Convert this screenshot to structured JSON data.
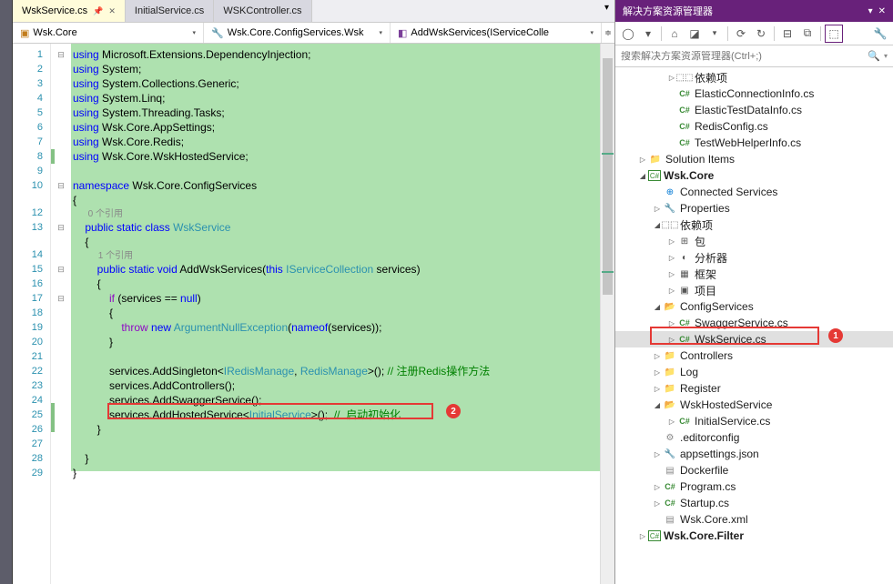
{
  "tabs": [
    {
      "label": "WskService.cs",
      "active": true
    },
    {
      "label": "InitialService.cs",
      "active": false
    },
    {
      "label": "WSKController.cs",
      "active": false
    }
  ],
  "nav": {
    "project": "Wsk.Core",
    "class": "Wsk.Core.ConfigServices.Wsk",
    "method": "AddWskServices(IServiceColle"
  },
  "lines": [
    "1",
    "2",
    "3",
    "4",
    "5",
    "6",
    "7",
    "8",
    "9",
    "10",
    "",
    "12",
    "13",
    "",
    "14",
    "15",
    "16",
    "17",
    "18",
    "19",
    "20",
    "21",
    "22",
    "23",
    "24",
    "25",
    "26",
    "27",
    "28",
    "29"
  ],
  "ref1": "0 个引用",
  "ref2": "1 个引用",
  "code": {
    "using1": "Microsoft.Extensions.DependencyInjection",
    "using2": "System",
    "using3": "System.Collections.Generic",
    "using4": "System.Linq",
    "using5": "System.Threading.Tasks",
    "using6": "Wsk.Core.AppSettings",
    "using7": "Wsk.Core.Redis",
    "using8": "Wsk.Core.WskHostedService",
    "namespace_kw": "namespace",
    "namespace": "Wsk.Core.ConfigServices",
    "class_decl": "WskService",
    "method_ret": "void",
    "method_name": "AddWskServices",
    "this_kw": "this",
    "param_ty": "IServiceCollection",
    "param_nm": "services",
    "if_kw": "if",
    "null_kw": "null",
    "throw_kw": "throw",
    "new_kw": "new",
    "ane": "ArgumentNullException",
    "nameof": "nameof",
    "addsingle": "AddSingleton",
    "imanage": "IRedisManage",
    "manage": "RedisManage",
    "cm1": "// 注册Redis操作方法",
    "addctrl": "AddControllers",
    "addswag": "AddSwaggerService",
    "addhost": "AddHostedService",
    "initsvc": "InitialService",
    "cm2": "//  启动初始化"
  },
  "panel": {
    "title": "解决方案资源管理器",
    "search_placeholder": "搜索解决方案资源管理器(Ctrl+;)"
  },
  "tree": [
    {
      "depth": 3,
      "exp": "▷",
      "icon": "ref",
      "glyph": "⬚⬚",
      "label": "依赖项"
    },
    {
      "depth": 3,
      "exp": "",
      "icon": "cs",
      "glyph": "C#",
      "label": "ElasticConnectionInfo.cs"
    },
    {
      "depth": 3,
      "exp": "",
      "icon": "cs",
      "glyph": "C#",
      "label": "ElasticTestDataInfo.cs"
    },
    {
      "depth": 3,
      "exp": "",
      "icon": "cs",
      "glyph": "C#",
      "label": "RedisConfig.cs"
    },
    {
      "depth": 3,
      "exp": "",
      "icon": "cs",
      "glyph": "C#",
      "label": "TestWebHelperInfo.cs"
    },
    {
      "depth": 1,
      "exp": "▷",
      "icon": "folder",
      "glyph": "📁",
      "label": "Solution Items"
    },
    {
      "depth": 1,
      "exp": "◢",
      "icon": "proj",
      "glyph": "C#",
      "label": "Wsk.Core",
      "bold": true
    },
    {
      "depth": 2,
      "exp": "",
      "icon": "conn",
      "glyph": "⊕",
      "label": "Connected Services"
    },
    {
      "depth": 2,
      "exp": "▷",
      "icon": "gear",
      "glyph": "🔧",
      "label": "Properties"
    },
    {
      "depth": 2,
      "exp": "◢",
      "icon": "ref",
      "glyph": "⬚⬚",
      "label": "依赖项"
    },
    {
      "depth": 3,
      "exp": "▷",
      "icon": "ref",
      "glyph": "⊞",
      "label": "包"
    },
    {
      "depth": 3,
      "exp": "▷",
      "icon": "ref",
      "glyph": "◐",
      "label": "分析器"
    },
    {
      "depth": 3,
      "exp": "▷",
      "icon": "ref",
      "glyph": "▦",
      "label": "框架"
    },
    {
      "depth": 3,
      "exp": "▷",
      "icon": "ref",
      "glyph": "▣",
      "label": "项目"
    },
    {
      "depth": 2,
      "exp": "◢",
      "icon": "folder",
      "glyph": "📂",
      "label": "ConfigServices"
    },
    {
      "depth": 3,
      "exp": "▷",
      "icon": "cs",
      "glyph": "C#",
      "label": "SwaggerService.cs"
    },
    {
      "depth": 3,
      "exp": "▷",
      "icon": "cs",
      "glyph": "C#",
      "label": "WskService.cs",
      "sel": true
    },
    {
      "depth": 2,
      "exp": "▷",
      "icon": "folder",
      "glyph": "📁",
      "label": "Controllers"
    },
    {
      "depth": 2,
      "exp": "▷",
      "icon": "folder",
      "glyph": "📁",
      "label": "Log"
    },
    {
      "depth": 2,
      "exp": "▷",
      "icon": "folder",
      "glyph": "📁",
      "label": "Register"
    },
    {
      "depth": 2,
      "exp": "◢",
      "icon": "folder",
      "glyph": "📂",
      "label": "WskHostedService"
    },
    {
      "depth": 3,
      "exp": "▷",
      "icon": "cs",
      "glyph": "C#",
      "label": "InitialService.cs"
    },
    {
      "depth": 2,
      "exp": "",
      "icon": "json",
      "glyph": "⚙",
      "label": ".editorconfig"
    },
    {
      "depth": 2,
      "exp": "▷",
      "icon": "json",
      "glyph": "🔧",
      "label": "appsettings.json"
    },
    {
      "depth": 2,
      "exp": "",
      "icon": "json",
      "glyph": "▤",
      "label": "Dockerfile"
    },
    {
      "depth": 2,
      "exp": "▷",
      "icon": "cs",
      "glyph": "C#",
      "label": "Program.cs"
    },
    {
      "depth": 2,
      "exp": "▷",
      "icon": "cs",
      "glyph": "C#",
      "label": "Startup.cs"
    },
    {
      "depth": 2,
      "exp": "",
      "icon": "json",
      "glyph": "▤",
      "label": "Wsk.Core.xml"
    },
    {
      "depth": 1,
      "exp": "▷",
      "icon": "proj",
      "glyph": "C#",
      "label": "Wsk.Core.Filter",
      "bold": true
    }
  ],
  "badges": {
    "b1": "1",
    "b2": "2"
  }
}
